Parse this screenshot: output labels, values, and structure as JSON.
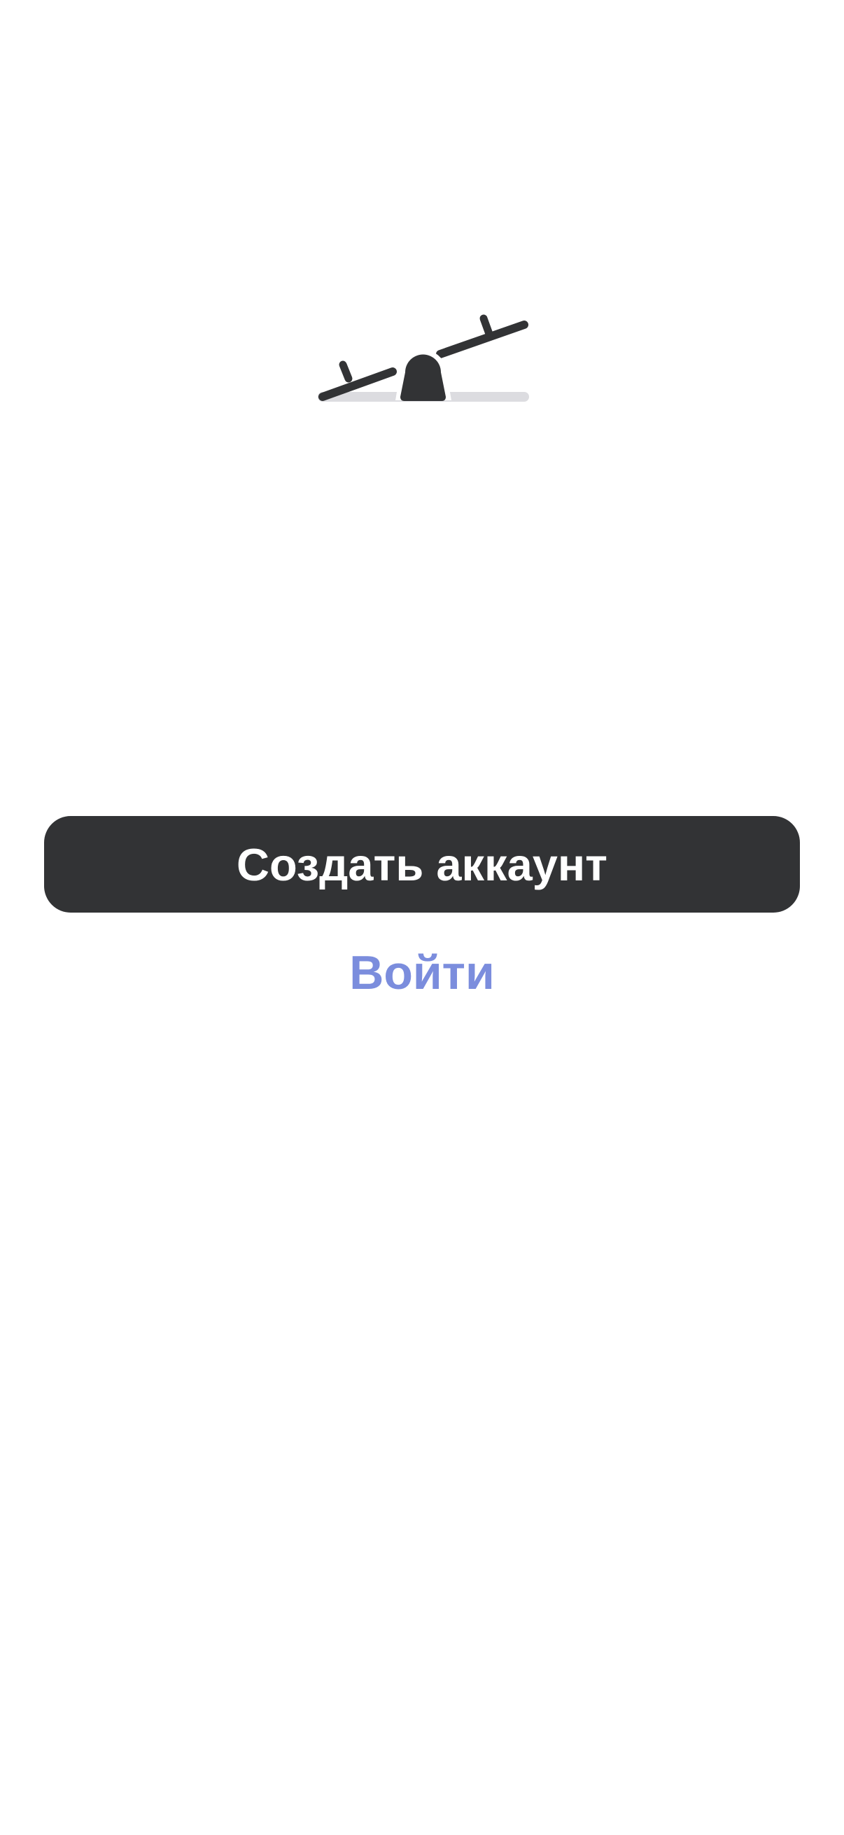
{
  "logo": {
    "icon": "seesaw-icon",
    "color": "#323335",
    "ground_color": "#dcdce0"
  },
  "actions": {
    "create_account_label": "Создать аккаунт",
    "login_label": "Войти"
  },
  "colors": {
    "primary_button_bg": "#323335",
    "primary_button_text": "#ffffff",
    "link_text": "#7b8ddd",
    "background": "#ffffff"
  }
}
